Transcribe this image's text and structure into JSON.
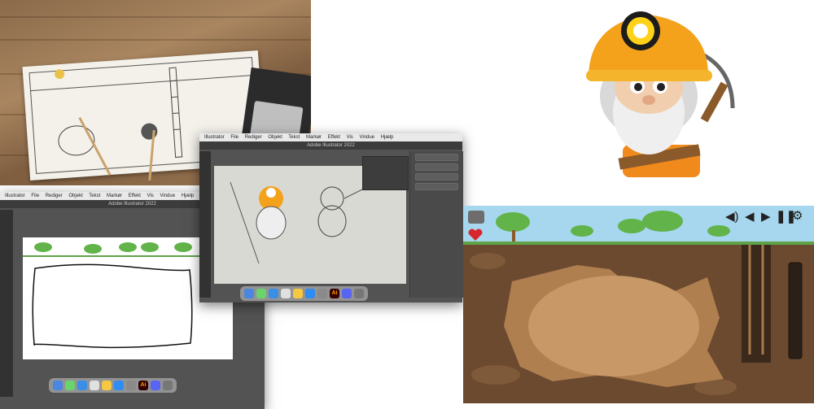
{
  "sketch_photo": {
    "caption": ""
  },
  "window_left": {
    "app_menu": [
      "Illustrator",
      "File",
      "Rediger",
      "Objekt",
      "Tekst",
      "Markør",
      "Effekt",
      "Vis",
      "Vindue",
      "Hjælp"
    ],
    "title": "Adobe Illustrator 2022"
  },
  "window_center": {
    "app_menu": [
      "Illustrator",
      "File",
      "Rediger",
      "Objekt",
      "Tekst",
      "Markør",
      "Effekt",
      "Vis",
      "Vindue",
      "Hjælp"
    ],
    "title": "Adobe Illustrator 2022"
  },
  "dock_left": {
    "ai_label": "Ai"
  },
  "dock_center": {
    "ai_label": "Ai"
  },
  "game": {
    "sound_icon": "speaker-icon",
    "prev_icon": "prev-icon",
    "next_icon": "next-icon",
    "pause_icon": "pause-icon",
    "settings_icon": "gear-icon",
    "life_icon": "heart-icon"
  },
  "colors": {
    "helmet": "#f4a11c",
    "dirt": "#6b4a2f",
    "cave": "#a9784c",
    "sky": "#a7d7ee",
    "heart": "#d8262e"
  }
}
